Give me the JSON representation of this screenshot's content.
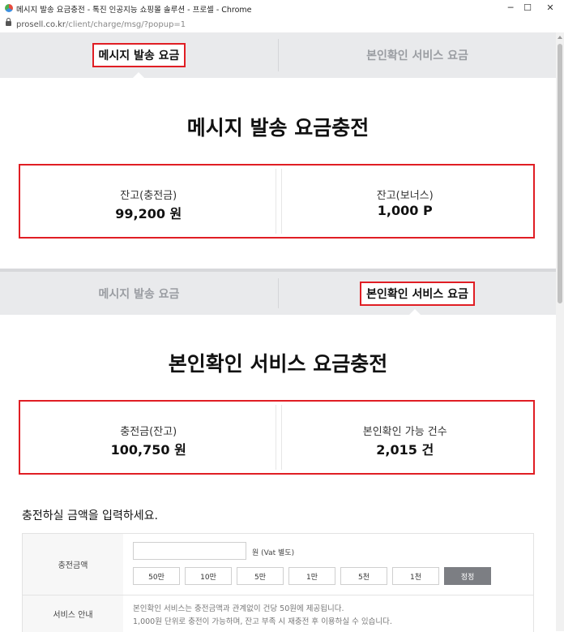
{
  "window": {
    "title": "메시지 발송 요금충전 - 톡진 인공지능 쇼핑몰 솔루션 - 프로셀 - Chrome",
    "url_host": "prosell.co.kr",
    "url_path": "/client/charge/msg/?popup=1",
    "minimize": "─",
    "maximize": "☐",
    "close": "✕"
  },
  "section1": {
    "tabs": [
      {
        "label": "메시지 발송 요금",
        "active": true
      },
      {
        "label": "본인확인 서비스 요금",
        "active": false
      }
    ],
    "heading": "메시지 발송 요금충전",
    "cards": [
      {
        "label": "잔고(충전금)",
        "value": "99,200 원"
      },
      {
        "label": "잔고(보너스)",
        "value": "1,000 P"
      }
    ]
  },
  "section2": {
    "tabs": [
      {
        "label": "메시지 발송 요금",
        "active": false
      },
      {
        "label": "본인확인 서비스 요금",
        "active": true
      }
    ],
    "heading": "본인확인 서비스 요금충전",
    "cards": [
      {
        "label": "충전금(잔고)",
        "value": "100,750 원"
      },
      {
        "label": "본인확인 가능 건수",
        "value": "2,015 건"
      }
    ]
  },
  "form": {
    "prompt": "충전하실 금액을 입력하세요.",
    "amount_label": "충전금액",
    "amount_value": "",
    "unit_text": "원 (Vat 별도)",
    "quick_buttons": [
      "50만",
      "10만",
      "5만",
      "1만",
      "5천",
      "1천"
    ],
    "correct_button": "정정",
    "service_label": "서비스 안내",
    "service_lines": [
      "본인확인 서비스는 충전금액과 관계없이 건당 50원에 제공됩니다.",
      "1,000원 단위로 충전이 가능하며, 잔고 부족 시 재충전 후 이용하실 수 있습니다."
    ]
  }
}
